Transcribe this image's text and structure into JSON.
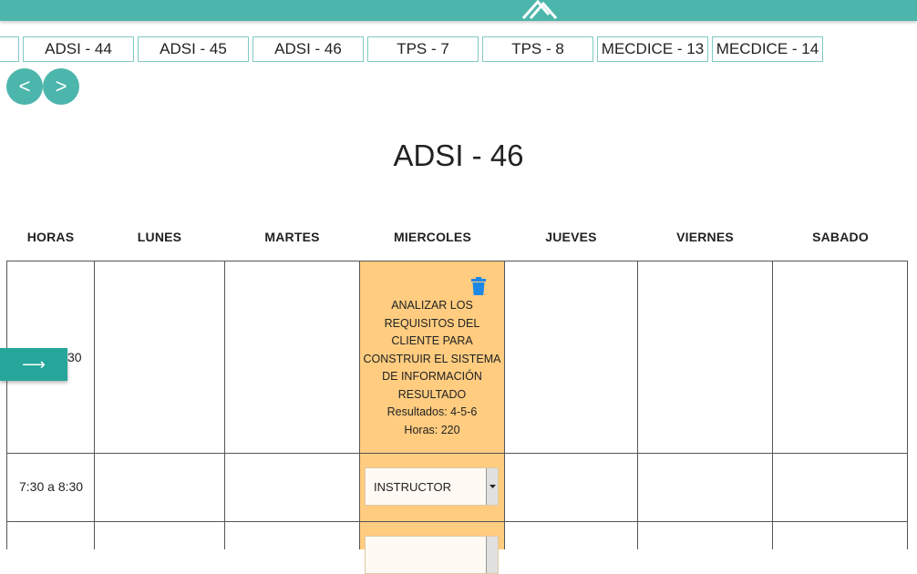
{
  "tabs": [
    "ADSI - 44",
    "ADSI - 45",
    "ADSI - 46",
    "TPS - 7",
    "TPS - 8",
    "MECDICE - 13",
    "MECDICE - 14"
  ],
  "nav": {
    "prev": "<",
    "next": ">"
  },
  "page_title": "ADSI - 46",
  "days": [
    "HORAS",
    "LUNES",
    "MARTES",
    "MIERCOLES",
    "JUEVES",
    "VIERNES",
    "SABADO"
  ],
  "rows": [
    {
      "hour": "30"
    },
    {
      "hour": "7:30 a 8:30"
    }
  ],
  "slot": {
    "subject": "ANALIZAR LOS REQUISITOS DEL CLIENTE PARA CONSTRUIR EL SISTEMA DE INFORMACIÓN RESULTADO",
    "results": "Resultados: 4-5-6",
    "hours": "Horas: 220"
  },
  "instructor_select": {
    "value": "INSTRUCTOR"
  },
  "fab": {
    "label": "⟶"
  },
  "icons": {
    "delete": "delete-icon",
    "logo": "logo-icon"
  },
  "colors": {
    "primary": "#4db6ac",
    "highlight": "#ffcc80",
    "delete": "#1e88e5"
  }
}
